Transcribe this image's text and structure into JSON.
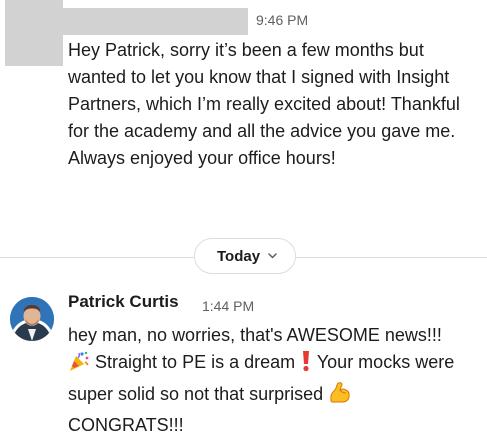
{
  "previous_message": {
    "time": "9:46 PM",
    "text": "Hey Patrick, sorry it’s been a few months but wanted to let you know that I signed with Insight Partners, which I’m really excited about! Thankful for the academy and all the advice you gave me. Always enjoyed your office hours!"
  },
  "date_divider": {
    "label": "Today",
    "chevron_icon": "chevron-down-icon"
  },
  "reply": {
    "sender": "Patrick Curtis",
    "time": "1:44 PM",
    "part1": "hey man, no worries, that's AWESOME news!!!",
    "part2": "Straight to PE is a dream",
    "part3": "Your mocks were super solid so not that surprised",
    "part4": "CONGRATS!!!",
    "emoji_icons": [
      "party-popper-icon",
      "exclamation-icon",
      "flexed-biceps-icon"
    ]
  },
  "colors": {
    "text": "#1d1c1d",
    "muted": "#616061",
    "divider": "#dddddd",
    "redacted": "#d2d2d2"
  }
}
